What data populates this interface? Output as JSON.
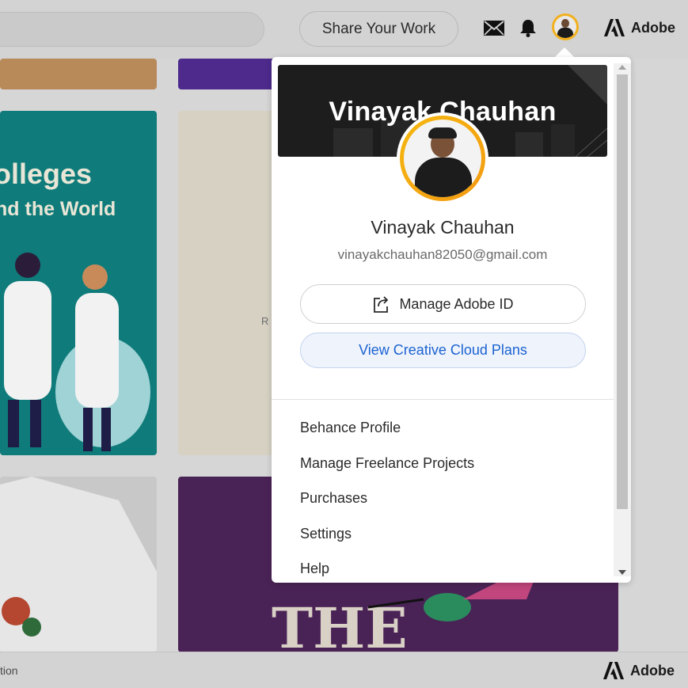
{
  "header": {
    "share_button": "Share Your Work",
    "brand": "Adobe",
    "icons": [
      "mail-icon",
      "bell-icon",
      "avatar",
      "adobe-logo-icon"
    ]
  },
  "gallery": {
    "teal_title": "olleges",
    "teal_subtitle": "nd the World",
    "beige_letter": "R",
    "violet_text": "THE"
  },
  "footer": {
    "left_text": "tion",
    "brand": "Adobe"
  },
  "profile_menu": {
    "banner_name": "Vinayak Chauhan",
    "name": "Vinayak Chauhan",
    "email": "vinayakchauhan82050@gmail.com",
    "manage_button": "Manage Adobe ID",
    "plans_button": "View Creative Cloud Plans",
    "items": [
      {
        "label": "Behance Profile"
      },
      {
        "label": "Manage Freelance Projects"
      },
      {
        "label": "Purchases"
      },
      {
        "label": "Settings"
      },
      {
        "label": "Help"
      }
    ]
  },
  "colors": {
    "accent_blue": "#1c63d1",
    "avatar_ring": "#f5b80f",
    "overlay_gray": "#d6d6d6"
  }
}
